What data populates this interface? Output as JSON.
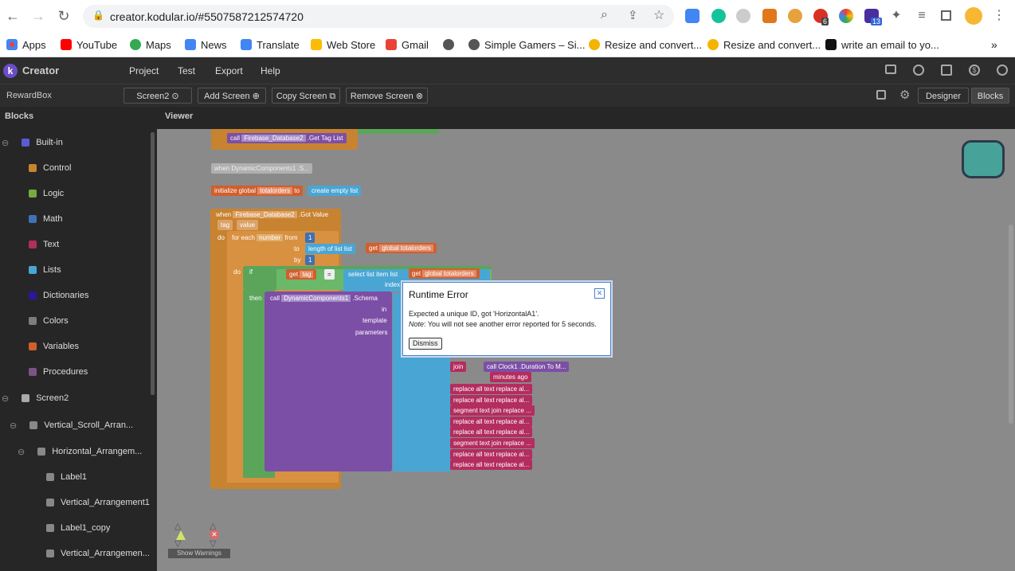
{
  "browser": {
    "url": "creator.kodular.io/#5507587212574720",
    "bookmarks": [
      "Apps",
      "YouTube",
      "Maps",
      "News",
      "Translate",
      "Web Store",
      "Gmail",
      "Simple Gamers – Si...",
      "Resize and convert...",
      "Resize and convert...",
      "write an email to yo..."
    ],
    "extension_badges": [
      "6",
      "13"
    ],
    "overflow_label": "»"
  },
  "app": {
    "logo_letter": "k",
    "name": "Creator",
    "menus": [
      "Project",
      "Test",
      "Export",
      "Help"
    ],
    "project_name": "RewardBox",
    "screen_select": "Screen2",
    "add_screen": "Add Screen",
    "copy_screen": "Copy Screen",
    "remove_screen": "Remove Screen",
    "designer": "Designer",
    "blocks": "Blocks",
    "blocks_panel_title": "Blocks",
    "viewer_title": "Viewer"
  },
  "tree": {
    "builtin": "Built-in",
    "builtin_items": [
      {
        "label": "Control",
        "color": "#c88330"
      },
      {
        "label": "Logic",
        "color": "#77ab41"
      },
      {
        "label": "Math",
        "color": "#3f71b5"
      },
      {
        "label": "Text",
        "color": "#b32d5e"
      },
      {
        "label": "Lists",
        "color": "#49a6d4"
      },
      {
        "label": "Dictionaries",
        "color": "#2d1799"
      },
      {
        "label": "Colors",
        "color": "#7d7d7d"
      },
      {
        "label": "Variables",
        "color": "#d05f2d"
      },
      {
        "label": "Procedures",
        "color": "#7c5385"
      }
    ],
    "screen": "Screen2",
    "components": [
      "Vertical_Scroll_Arran...",
      "Horizontal_Arrangem...",
      "Label1",
      "Vertical_Arrangement1",
      "Label1_copy",
      "Vertical_Arrangemen..."
    ]
  },
  "blocks": {
    "call_get_tag": "call",
    "firebase2": "Firebase_Database2",
    "get_tag_list": ".Get Tag List",
    "when_dyn": "when  DynamicComponents1 .S...",
    "initialize_global": "initialize global",
    "totalorders": "totalorders",
    "to": "to",
    "create_empty_list": "create empty list",
    "when": "when",
    "got_value": ".Got Value",
    "tag": "tag",
    "value": "value",
    "do": "do",
    "for_each": "for each",
    "number": "number",
    "from": "from",
    "one": "1",
    "length_of_list": "length of list  list",
    "get": "get",
    "global_totalorders": "global totalorders",
    "by": "by",
    "if": "if",
    "get_tag": "tag",
    "eq": "=",
    "select_list_item": "select list item  list",
    "index": "index",
    "then": "then",
    "call": "call",
    "dyn1": "DynamicComponents1",
    "schema": ".Schema",
    "in": "in",
    "template": "template",
    "parameters": "parameters",
    "join": "join",
    "clock_call": "call  Clock1 .Duration To M...",
    "minutes_ago": "minutes ago",
    "rows": [
      "replace all text replace al...",
      "replace all text replace al...",
      "segment  text join replace ...",
      "replace all text replace al...",
      "replace all text replace al...",
      "segment  text join replace ...",
      "replace all text replace al...",
      "replace all text replace al..."
    ],
    "show_warnings": "Show Warnings",
    "warn_count": "0",
    "err_count": "0"
  },
  "dialog": {
    "title": "Runtime Error",
    "message": "Expected a unique ID, got 'HorizontalA1'.",
    "note_label": "Note",
    "note_text": ": You will not see another error reported for 5 seconds.",
    "dismiss": "Dismiss"
  },
  "colors": {
    "control": "#c88330",
    "text": "#b32d5e",
    "lists": "#49a6d4",
    "component": "#7c4fa6",
    "variables": "#d05f2d",
    "logic": "#5ba55b",
    "math": "#3f71b5"
  }
}
